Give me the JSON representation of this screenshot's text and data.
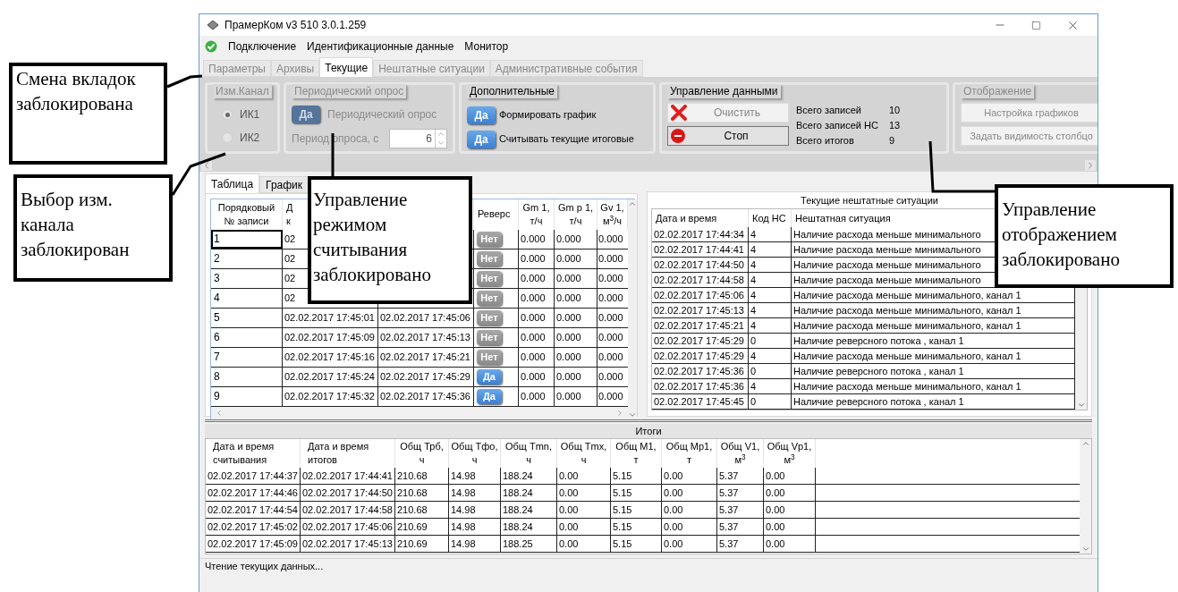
{
  "callouts": [
    {
      "text": "Смена вкладок заблокирована"
    },
    {
      "text": "Выбор изм. канала заблокирован"
    },
    {
      "text": "Управление режимом считывания заблокировано"
    },
    {
      "text": "Управление отображением заблокировано"
    }
  ],
  "window": {
    "title": "ПрамерКом v3 510 3.0.1.259"
  },
  "menu": [
    "Подключение",
    "Идентификационные данные",
    "Монитор"
  ],
  "tabs": [
    {
      "label": "Параметры",
      "selected": false
    },
    {
      "label": "Архивы",
      "selected": false
    },
    {
      "label": "Текущие",
      "selected": true
    },
    {
      "label": "Нештатные ситуации",
      "selected": false
    },
    {
      "label": "Административные события",
      "selected": false
    }
  ],
  "channel_group": {
    "title": "Изм.Канал",
    "disabled": true,
    "options": [
      {
        "label": "ИК1",
        "selected": true
      },
      {
        "label": "ИК2",
        "selected": false
      }
    ]
  },
  "periodic_group": {
    "title": "Периодический опрос",
    "disabled": true,
    "toggle": {
      "text": "Да",
      "on": true
    },
    "toggle_label": "Периодический опрос",
    "period_label": "Период опроса, с",
    "period_value": "6"
  },
  "extra_group": {
    "title": "Дополнительные",
    "disabled": false,
    "items": [
      {
        "toggle": {
          "text": "Да",
          "on": true
        },
        "label": "Формировать график"
      },
      {
        "toggle": {
          "text": "Да",
          "on": true
        },
        "label": "Считывать текущие итоговые"
      }
    ]
  },
  "data_group": {
    "title": "Управление данными",
    "disabled": false,
    "buttons": [
      {
        "label": "Очистить",
        "kind": "clear",
        "disabled": true
      },
      {
        "label": "Стоп",
        "kind": "stop",
        "disabled": false
      }
    ],
    "stats": [
      {
        "label": "Всего записей",
        "value": "10"
      },
      {
        "label": "Всего записей НС",
        "value": "13"
      },
      {
        "label": "Всего итогов",
        "value": "9"
      }
    ]
  },
  "display_group": {
    "title": "Отображение",
    "disabled": true,
    "buttons": [
      "Настройка графиков",
      "Задать видимость столбцо"
    ]
  },
  "view_tabs": [
    {
      "label": "Таблица",
      "selected": true
    },
    {
      "label": "График",
      "selected": false
    }
  ],
  "records": {
    "columns": [
      {
        "lines": [
          "Порядковый",
          "№ записи"
        ]
      },
      {
        "lines": [
          "Д",
          "к"
        ]
      },
      {},
      {
        "lines": [
          "Реверс"
        ]
      },
      {
        "lines": [
          "Gm 1,",
          "т/ч"
        ]
      },
      {
        "lines": [
          "Gm p 1,",
          "т/ч"
        ]
      },
      {
        "lines": [
          "Gv 1,",
          "м$^{3}$/ч"
        ]
      }
    ],
    "rows": [
      {
        "selected": true,
        "number": "1",
        "read_time": "02",
        "reverse": {
          "text": "Нет",
          "on": false
        },
        "gm1": "0.000",
        "gmp1": "0.000",
        "gv1": "0.000"
      },
      {
        "selected": false,
        "number": "2",
        "read_time": "02",
        "reverse": {
          "text": "Нет",
          "on": false
        },
        "gm1": "0.000",
        "gmp1": "0.000",
        "gv1": "0.000"
      },
      {
        "selected": false,
        "number": "3",
        "read_time": "02",
        "reverse": {
          "text": "Нет",
          "on": false
        },
        "gm1": "0.000",
        "gmp1": "0.000",
        "gv1": "0.000"
      },
      {
        "selected": false,
        "number": "4",
        "read_time": "02",
        "reverse": {
          "text": "Нет",
          "on": false
        },
        "gm1": "0.000",
        "gmp1": "0.000",
        "gv1": "0.000"
      },
      {
        "selected": false,
        "number": "5",
        "read_time": "02.02.2017 17:45:01",
        "total_time": "02.02.2017 17:45:06",
        "reverse": {
          "text": "Нет",
          "on": false
        },
        "gm1": "0.000",
        "gmp1": "0.000",
        "gv1": "0.000"
      },
      {
        "selected": false,
        "number": "6",
        "read_time": "02.02.2017 17:45:09",
        "total_time": "02.02.2017 17:45:13",
        "reverse": {
          "text": "Нет",
          "on": false
        },
        "gm1": "0.000",
        "gmp1": "0.000",
        "gv1": "0.000"
      },
      {
        "selected": false,
        "number": "7",
        "read_time": "02.02.2017 17:45:16",
        "total_time": "02.02.2017 17:45:21",
        "reverse": {
          "text": "Нет",
          "on": false
        },
        "gm1": "0.000",
        "gmp1": "0.000",
        "gv1": "0.000"
      },
      {
        "selected": false,
        "number": "8",
        "read_time": "02.02.2017 17:45:24",
        "total_time": "02.02.2017 17:45:29",
        "reverse": {
          "text": "Да",
          "on": true
        },
        "gm1": "0.000",
        "gmp1": "0.000",
        "gv1": "0.000"
      },
      {
        "selected": false,
        "number": "9",
        "read_time": "02.02.2017 17:45:32",
        "total_time": "02.02.2017 17:45:36",
        "reverse": {
          "text": "Да",
          "on": true
        },
        "gm1": "0.000",
        "gmp1": "0.000",
        "gv1": "0.000"
      }
    ]
  },
  "alarms": {
    "title": "Текущие нештатные ситуации",
    "columns": [
      "Дата и время",
      "Код НС",
      "Нештатная ситуация"
    ],
    "rows": [
      [
        "02.02.2017 17:44:34",
        "4",
        "Наличие расхода меньше минимального"
      ],
      [
        "02.02.2017 17:44:41",
        "4",
        "Наличие расхода меньше минимального"
      ],
      [
        "02.02.2017 17:44:50",
        "4",
        "Наличие расхода меньше минимального"
      ],
      [
        "02.02.2017 17:44:58",
        "4",
        "Наличие расхода меньше минимального"
      ],
      [
        "02.02.2017 17:45:06",
        "4",
        "Наличие расхода меньше минимального, канал 1"
      ],
      [
        "02.02.2017 17:45:13",
        "4",
        "Наличие расхода меньше минимального, канал 1"
      ],
      [
        "02.02.2017 17:45:21",
        "4",
        "Наличие расхода меньше минимального, канал 1"
      ],
      [
        "02.02.2017 17:45:29",
        "0",
        "Наличие реверсного потока , канал 1"
      ],
      [
        "02.02.2017 17:45:29",
        "4",
        "Наличие расхода меньше минимального, канал 1"
      ],
      [
        "02.02.2017 17:45:36",
        "0",
        "Наличие реверсного потока , канал 1"
      ],
      [
        "02.02.2017 17:45:36",
        "4",
        "Наличие расхода меньше минимального, канал 1"
      ],
      [
        "02.02.2017 17:45:45",
        "0",
        "Наличие реверсного потока , канал 1"
      ]
    ]
  },
  "totals": {
    "title": "Итоги",
    "columns": [
      {
        "lines": [
          "Дата и время",
          "считывания"
        ]
      },
      {
        "lines": [
          "Дата и время",
          "итогов"
        ]
      },
      {
        "lines": [
          "Общ Трб,",
          "ч"
        ]
      },
      {
        "lines": [
          "Общ Тфо,",
          "ч"
        ]
      },
      {
        "lines": [
          "Общ Tmn,",
          "ч"
        ]
      },
      {
        "lines": [
          "Общ Tmx,",
          "ч"
        ]
      },
      {
        "lines": [
          "Общ М1,",
          "т"
        ]
      },
      {
        "lines": [
          "Общ Мр1,",
          "т"
        ]
      },
      {
        "lines": [
          "Общ V1,",
          "м$^{3}$"
        ]
      },
      {
        "lines": [
          "Общ Vp1,",
          "м$^{3}$"
        ]
      }
    ],
    "rows": [
      [
        "02.02.2017 17:44:37",
        "02.02.2017 17:44:41",
        "210.68",
        "14.98",
        "188.24",
        "0.00",
        "5.15",
        "0.00",
        "5.37",
        "0.00"
      ],
      [
        "02.02.2017 17:44:46",
        "02.02.2017 17:44:50",
        "210.68",
        "14.98",
        "188.24",
        "0.00",
        "5.15",
        "0.00",
        "5.37",
        "0.00"
      ],
      [
        "02.02.2017 17:44:54",
        "02.02.2017 17:44:58",
        "210.68",
        "14.98",
        "188.24",
        "0.00",
        "5.15",
        "0.00",
        "5.37",
        "0.00"
      ],
      [
        "02.02.2017 17:45:02",
        "02.02.2017 17:45:06",
        "210.69",
        "14.98",
        "188.24",
        "0.00",
        "5.15",
        "0.00",
        "5.37",
        "0.00"
      ],
      [
        "02.02.2017 17:45:09",
        "02.02.2017 17:45:13",
        "210.69",
        "14.98",
        "188.25",
        "0.00",
        "5.15",
        "0.00",
        "5.37",
        "0.00"
      ]
    ]
  },
  "status_bar": "Чтение текущих данных..."
}
